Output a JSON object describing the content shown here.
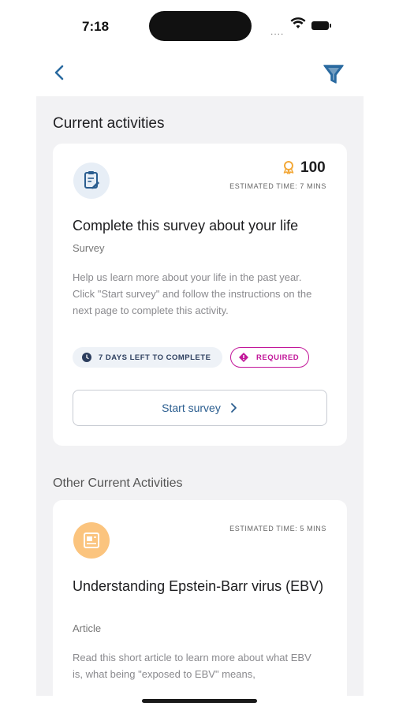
{
  "status_bar": {
    "time": "7:18",
    "signal_text": "...."
  },
  "colors": {
    "accent": "#2a5d8f",
    "required": "#c2179a",
    "article_icon_bg": "#fbc47e",
    "survey_icon_bg": "#e7eef6"
  },
  "main": {
    "current_title": "Current activities",
    "survey_card": {
      "icon": "clipboard-edit-icon",
      "points": "100",
      "points_icon": "award-icon",
      "estimated_time": "ESTIMATED TIME: 7 MINS",
      "title": "Complete this survey about your life",
      "type": "Survey",
      "description": "Help us learn more about your life in the past year. Click \"Start survey\" and follow the instructions on the next page to complete this activity.",
      "tag_days": "7 DAYS LEFT TO COMPLETE",
      "tag_required": "REQUIRED",
      "button_label": "Start survey"
    },
    "other_title": "Other Current Activities",
    "article_card": {
      "icon": "article-icon",
      "estimated_time": "ESTIMATED TIME: 5 MINS",
      "title": "Understanding Epstein-Barr virus (EBV)",
      "type": "Article",
      "description": "Read this short article to learn more about what EBV is, what being \"exposed to EBV\" means,"
    }
  }
}
